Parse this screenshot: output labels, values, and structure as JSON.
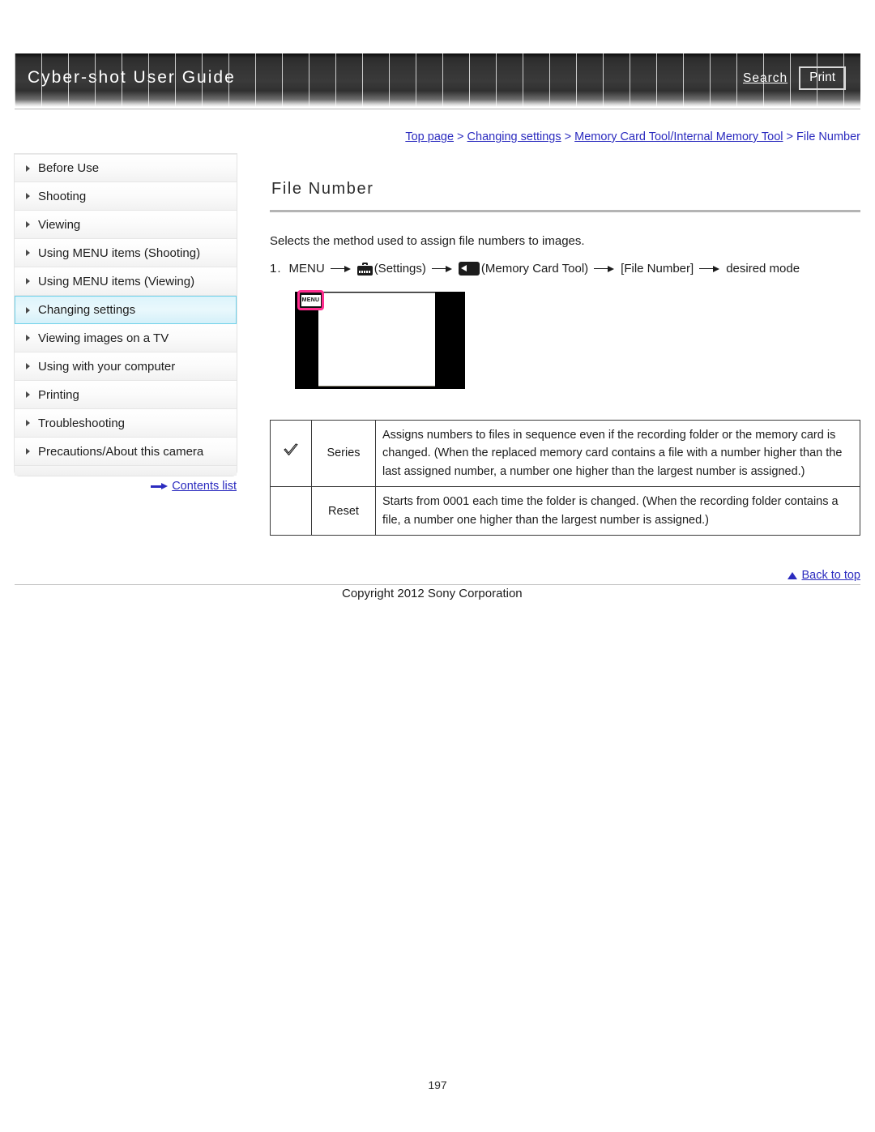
{
  "header": {
    "site_title": "Cyber-shot User Guide",
    "search_label": "Search",
    "print_label": "Print"
  },
  "breadcrumb": {
    "separator": " > ",
    "items": [
      {
        "label": "Top page"
      },
      {
        "label": "Changing settings"
      },
      {
        "label": "Memory Card Tool/Internal Memory Tool"
      },
      {
        "label": "File Number"
      }
    ]
  },
  "sidebar": {
    "items": [
      {
        "label": "Before Use",
        "active": false
      },
      {
        "label": "Shooting",
        "active": false
      },
      {
        "label": "Viewing",
        "active": false
      },
      {
        "label": "Using MENU items (Shooting)",
        "active": false
      },
      {
        "label": "Using MENU items (Viewing)",
        "active": false
      },
      {
        "label": "Changing settings",
        "active": true
      },
      {
        "label": "Viewing images on a TV",
        "active": false
      },
      {
        "label": "Using with your computer",
        "active": false
      },
      {
        "label": "Printing",
        "active": false
      },
      {
        "label": "Troubleshooting",
        "active": false
      },
      {
        "label": "Precautions/About this camera",
        "active": false
      }
    ],
    "contents_list_label": "Contents list"
  },
  "main": {
    "page_title": "File Number",
    "intro": "Selects the method used to assign file numbers to images.",
    "step": {
      "number": "1.",
      "part1": "MENU",
      "settings_label": "(Settings)",
      "memory_card_label": "(Memory Card Tool)",
      "file_number_label": "[File Number]",
      "desired_mode_label": "desired mode"
    },
    "illustration": {
      "menu_badge_label": "MENU"
    },
    "table": {
      "rows": [
        {
          "checked": "✓",
          "label": "Series",
          "description": "Assigns numbers to files in sequence even if the recording folder or the memory card is changed. (When the replaced memory card contains a file with a number higher than the last assigned number, a number one higher than the largest number is assigned.)"
        },
        {
          "checked": "",
          "label": "Reset",
          "description": "Starts from 0001 each time the folder is changed. (When the recording folder contains a file, a number one higher than the largest number is assigned.)"
        }
      ]
    }
  },
  "footer": {
    "back_to_top_label": "Back to top",
    "copyright": "Copyright 2012 Sony Corporation",
    "page_number": "197"
  },
  "colors": {
    "link_blue": "#2b2bbf",
    "active_nav_border": "#6fd2ea",
    "menu_highlight_pink": "#ff2d8f",
    "header_dark": "#333333"
  }
}
